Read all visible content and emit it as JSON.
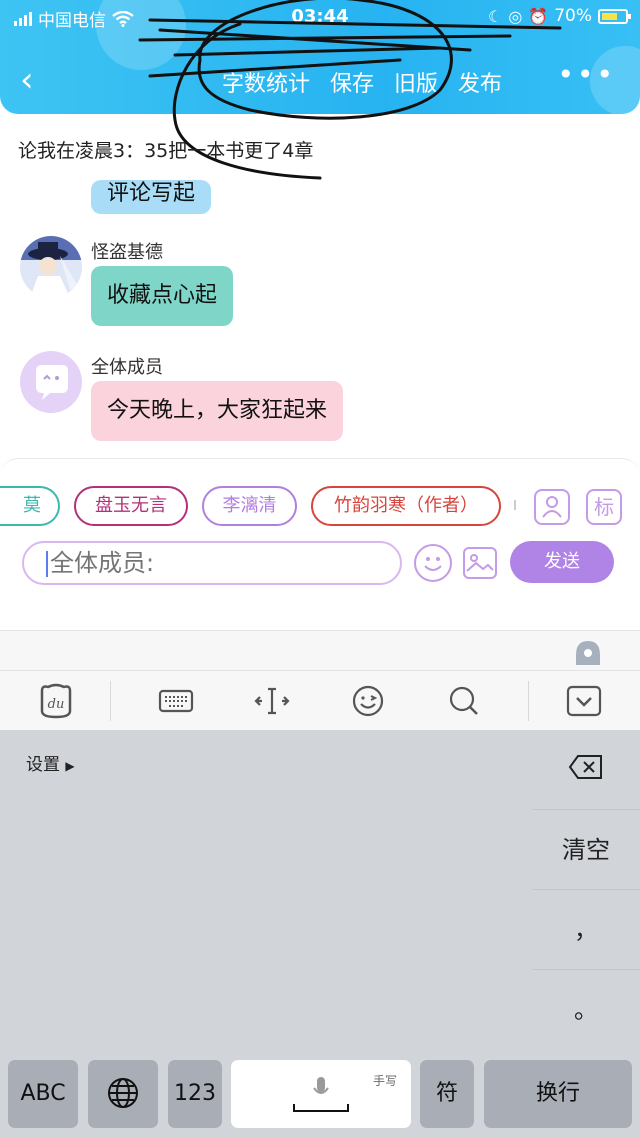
{
  "status": {
    "carrier": "中国电信",
    "time": "03:44",
    "battery": "70%"
  },
  "nav": {
    "actions": [
      "字数统计",
      "保存",
      "旧版",
      "发布"
    ],
    "more": "•••"
  },
  "subtitle": "论我在凌晨3：35把一本书更了4章",
  "messages": [
    {
      "sender": "",
      "text": "评论写起"
    },
    {
      "sender": "怪盗基德",
      "text": "收藏点心起"
    },
    {
      "sender": "全体成员",
      "text": "今天晚上，大家狂起来"
    }
  ],
  "chips": [
    "莫",
    "盘玉无言",
    "李漓清",
    "竹韵羽寒（作者）"
  ],
  "tag_button": "标",
  "input": {
    "placeholder": "全体成员:"
  },
  "send_label": "发送",
  "keyboard": {
    "settings": "设置",
    "clear": "清空",
    "comma": "，",
    "period": "。",
    "abc": "ABC",
    "num": "123",
    "handwrite": "手写",
    "symbol": "符",
    "enter": "换行"
  },
  "colors": {
    "header": "#27b3f1",
    "bubble_blue": "#a9dcf7",
    "bubble_teal": "#7fd6c8",
    "bubble_pink": "#fbd3dc",
    "send": "#b083e6",
    "chip_teal": "#3cb9ad",
    "chip_magenta": "#b4307a",
    "chip_purple": "#b27fe0",
    "chip_red": "#d6453e"
  }
}
